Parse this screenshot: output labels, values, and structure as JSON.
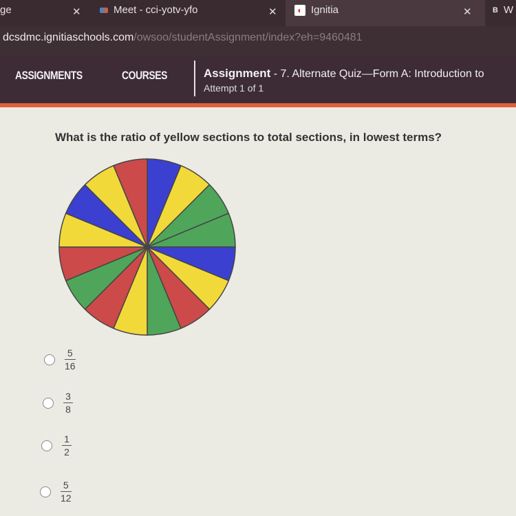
{
  "browser": {
    "tabs": [
      {
        "label": "ge",
        "icon": "page-icon"
      },
      {
        "label": "Meet - cci-yotv-yfo",
        "icon": "meet-icon"
      },
      {
        "label": "Ignitia",
        "icon": "ignitia-icon"
      },
      {
        "label": "W",
        "icon": "bold-b-icon"
      }
    ],
    "address_host": "dcsdmc.ignitiaschools.com",
    "address_path": "/owsoo/studentAssignment/index?eh=9460481"
  },
  "nav": {
    "assignments": "ASSIGNMENTS",
    "courses": "COURSES",
    "assignment_label": "Assignment",
    "assignment_title": " - 7. Alternate Quiz—Form A: Introduction to",
    "attempt": "Attempt 1 of 1",
    "accent_color": "#e0603a"
  },
  "question": "What is the ratio of yellow sections to total sections, in lowest terms?",
  "spinner": {
    "sections_clockwise_from_top": [
      "blue",
      "yellow",
      "green",
      "green",
      "blue",
      "yellow",
      "red",
      "green",
      "yellow",
      "red",
      "green",
      "red",
      "yellow",
      "blue",
      "yellow",
      "red"
    ],
    "colors": {
      "blue": "#3b40d0",
      "yellow": "#f2d93a",
      "green": "#4fa65a",
      "red": "#cc4a4a"
    }
  },
  "options": [
    {
      "num": "5",
      "den": "16"
    },
    {
      "num": "3",
      "den": "8"
    },
    {
      "num": "1",
      "den": "2"
    },
    {
      "num": "5",
      "den": "12"
    }
  ]
}
